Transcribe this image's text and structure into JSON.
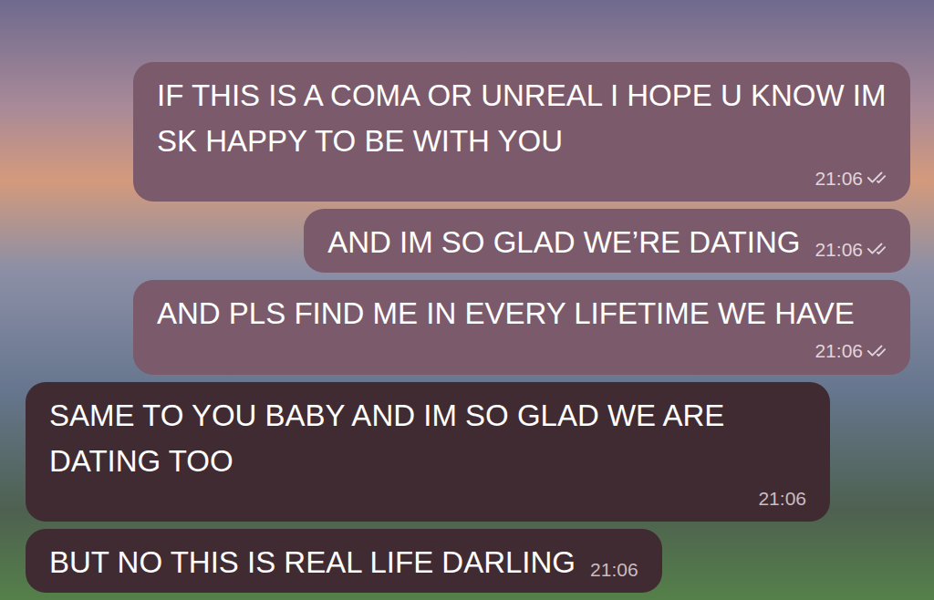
{
  "chat": {
    "messages": [
      {
        "text": "IF THIS IS A COMA OR UNREAL I HOPE U KNOW IM SK HAPPY TO BE WITH YOU",
        "time": "21:06",
        "outgoing": true,
        "delivered": true
      },
      {
        "text": "AND IM SO GLAD WE’RE DATING",
        "time": "21:06",
        "outgoing": true,
        "delivered": true
      },
      {
        "text": "AND PLS FIND ME IN EVERY LIFETIME WE HAVE",
        "time": "21:06",
        "outgoing": true,
        "delivered": true
      },
      {
        "text": "SAME TO YOU BABY AND IM SO GLAD WE ARE DATING TOO",
        "time": "21:06",
        "outgoing": false,
        "delivered": false
      },
      {
        "text": "BUT NO THIS IS REAL LIFE DARLING",
        "time": "21:06",
        "outgoing": false,
        "delivered": false
      }
    ]
  }
}
